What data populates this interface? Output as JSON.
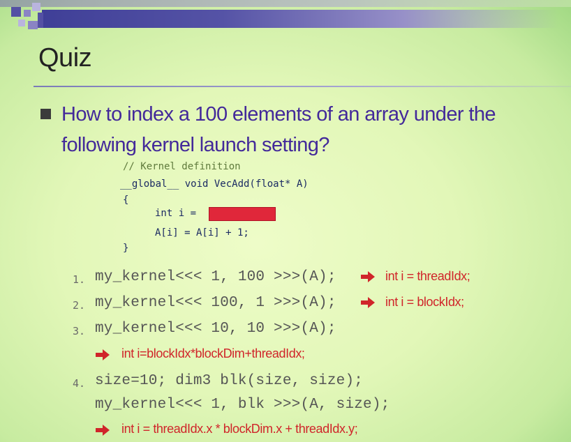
{
  "slide": {
    "title": "Quiz",
    "question": "How to index a 100 elements of an array under the following kernel launch setting?"
  },
  "code": {
    "comment": "// Kernel definition",
    "signature": "__global__ void VecAdd(float* A)",
    "open_brace": "{",
    "line_int": "int i =",
    "line_assign": "A[i] = A[i] + 1;",
    "close_brace": "}"
  },
  "items": [
    {
      "number": "1.",
      "code": "my_kernel<<< 1, 100 >>>(A);",
      "answer": "int i = threadIdx;"
    },
    {
      "number": "2.",
      "code": "my_kernel<<< 100, 1 >>>(A);",
      "answer": "int i = blockIdx;"
    },
    {
      "number": "3.",
      "code": "my_kernel<<< 10, 10 >>>(A);",
      "answer": "int i=blockIdx*blockDim+threadIdx;"
    },
    {
      "number": "4.",
      "code": "size=10; dim3 blk(size, size);",
      "code2": "my_kernel<<< 1, blk >>>(A, size);",
      "answer": "int i = threadIdx.x * blockDim.x + threadIdx.y;"
    }
  ],
  "colors": {
    "question_text": "#43299a",
    "answer_text": "#d0252a",
    "arrow": "#d0252a",
    "redaction": "#e0273a",
    "title_bar": "#3f3f97"
  }
}
